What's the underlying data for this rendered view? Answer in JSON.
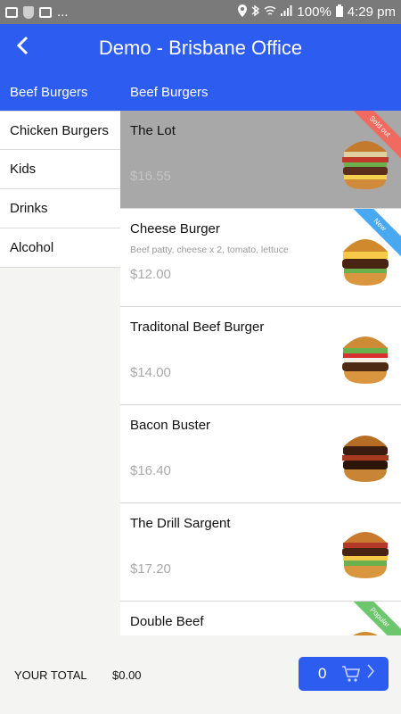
{
  "status_bar": {
    "battery": "100%",
    "time": "4:29 pm",
    "dots": "..."
  },
  "app_bar": {
    "title": "Demo - Brisbane Office",
    "back_icon": "back-arrow-icon"
  },
  "sub_bar": {
    "active_category": "Beef Burgers",
    "section_title": "Beef Burgers"
  },
  "categories": [
    "Chicken Burgers",
    "Kids",
    "Drinks",
    "Alcohol"
  ],
  "menu_items": [
    {
      "name": "The Lot",
      "description": "",
      "price": "$16.55",
      "ribbon": "Sold out",
      "ribbon_color": "#f16a5f"
    },
    {
      "name": "Cheese Burger",
      "description": "Beef patty, cheese x 2, tomato, lettuce",
      "price": "$12.00",
      "ribbon": "New",
      "ribbon_color": "#49a8f2"
    },
    {
      "name": "Traditonal Beef Burger",
      "description": "",
      "price": "$14.00",
      "ribbon": ""
    },
    {
      "name": "Bacon Buster",
      "description": "",
      "price": "$16.40",
      "ribbon": ""
    },
    {
      "name": "The Drill Sargent",
      "description": "",
      "price": "$17.20",
      "ribbon": ""
    },
    {
      "name": "Double Beef",
      "description": "",
      "price": "",
      "ribbon": "Popular",
      "ribbon_color": "#6cc66c"
    }
  ],
  "footer": {
    "total_label": "YOUR TOTAL",
    "total_value": "$0.00",
    "cart_count": "0"
  },
  "colors": {
    "primary": "#2d5cf0",
    "status_bar": "#7a7a7a"
  }
}
